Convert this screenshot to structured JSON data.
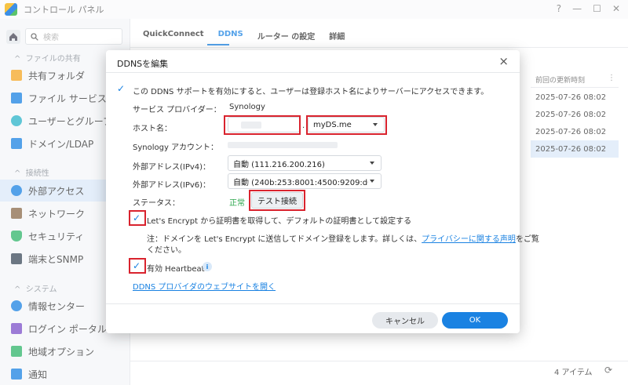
{
  "window": {
    "title": "コントロール パネル",
    "controls": [
      "?",
      "—",
      "☐",
      "✕"
    ]
  },
  "sidebar": {
    "search_placeholder": "検索",
    "sections": [
      {
        "label": "ファイルの共有"
      },
      {
        "label": "接続性"
      },
      {
        "label": "システム"
      }
    ],
    "items": [
      {
        "label": "共有フォルダ",
        "icon": "shared-folder-icon",
        "color": "#f5a623"
      },
      {
        "label": "ファイル サービス",
        "icon": "file-services-icon",
        "color": "#1a82e2"
      },
      {
        "label": "ユーザーとグループ",
        "icon": "users-icon",
        "color": "#2ab3c9"
      },
      {
        "label": "ドメイン/LDAP",
        "icon": "domain-icon",
        "color": "#1a82e2"
      },
      {
        "label": "外部アクセス",
        "icon": "external-access-icon",
        "color": "#1a82e2"
      },
      {
        "label": "ネットワーク",
        "icon": "network-icon",
        "color": "#8a6a4a"
      },
      {
        "label": "セキュリティ",
        "icon": "security-shield-icon",
        "color": "#2fb56a"
      },
      {
        "label": "端末とSNMP",
        "icon": "terminal-icon",
        "color": "#3b4a5a"
      },
      {
        "label": "情報センター",
        "icon": "info-center-icon",
        "color": "#1a82e2"
      },
      {
        "label": "ログイン ポータル",
        "icon": "login-portal-icon",
        "color": "#7b4fc9"
      },
      {
        "label": "地域オプション",
        "icon": "regional-options-icon",
        "color": "#2fb56a"
      },
      {
        "label": "通知",
        "icon": "notification-icon",
        "color": "#1a82e2"
      }
    ]
  },
  "tabs": [
    "QuickConnect",
    "DDNS",
    "ルーター の設定",
    "詳細"
  ],
  "table": {
    "column_header": "前回の更新時刻",
    "rows": [
      "2025-07-26 08:02",
      "2025-07-26 08:02",
      "2025-07-26 08:02",
      "2025-07-26 08:02"
    ],
    "item_count": "4 アイテム"
  },
  "dialog": {
    "title": "DDNSを編集",
    "enable_text": "この DDNS サポートを有効にすると、ユーザーは登録ホスト名によりサーバーにアクセスできます。",
    "provider_label": "サービス プロバイダー：",
    "provider_value": "Synology",
    "hostname_label": "ホスト名：",
    "hostname_value": "",
    "hostname_dot": ".",
    "domain_value": "myDS.me",
    "account_label": "Synology アカウント：",
    "ipv4_label": "外部アドレス(IPv4)：",
    "ipv4_value": "自動 (111.216.200.216)",
    "ipv6_label": "外部アドレス(IPv6)：",
    "ipv6_value": "自動 (240b:253:8001:4500:9209:d0",
    "status_label": "ステータス：",
    "status_value": "正常",
    "test_button": "テスト接続",
    "letsencrypt_text": "Let's Encrypt から証明書を取得して、デフォルトの証明書として設定する",
    "note_line1": "注：ドメインを Let's Encrypt に送信してドメイン登録をします。詳しくは、",
    "note_link": "プライバシーに関する声明",
    "note_line1_end": "をご覧",
    "note_line2": "ください。",
    "heartbeat_text": "有効 Heartbeat",
    "provider_link": "DDNS プロバイダのウェブサイトを開く",
    "cancel_button": "キャンセル",
    "ok_button": "OK"
  },
  "colors": {
    "accent": "#1a82e2",
    "highlight_box": "#d9232e",
    "status_ok": "#2aa54a"
  }
}
